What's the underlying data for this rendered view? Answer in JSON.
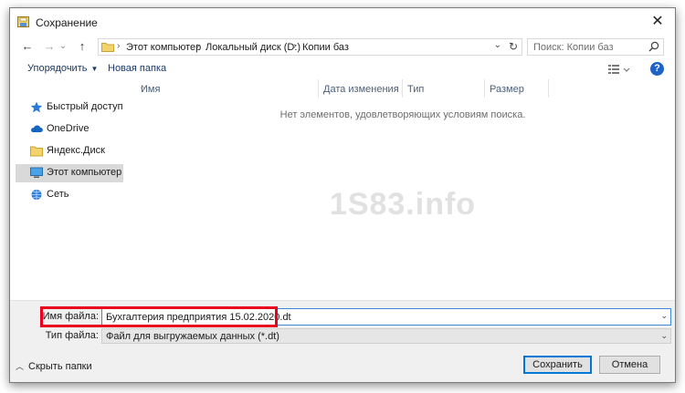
{
  "window": {
    "title": "Сохранение",
    "close_glyph": "✕"
  },
  "nav": {
    "back_glyph": "←",
    "forward_glyph": "→",
    "recent_glyph": "⌄",
    "up_glyph": "↑",
    "breadcrumbs": [
      "Этот компьютер",
      "Локальный диск (D:)",
      "Копии баз"
    ],
    "sep": "›",
    "addr_dropdown_glyph": "⌄",
    "refresh_glyph": "↻"
  },
  "search": {
    "placeholder": "Поиск: Копии баз"
  },
  "toolbar": {
    "organize_label": "Упорядочить",
    "organize_caret": "▼",
    "new_folder_label": "Новая папка",
    "help_glyph": "?"
  },
  "sidebar": {
    "items": [
      {
        "label": "Быстрый доступ",
        "icon": "star-icon"
      },
      {
        "label": "OneDrive",
        "icon": "cloud-icon"
      },
      {
        "label": "Яндекс.Диск",
        "icon": "folder-icon"
      },
      {
        "label": "Этот компьютер",
        "icon": "computer-icon",
        "selected": true
      },
      {
        "label": "Сеть",
        "icon": "network-icon"
      }
    ]
  },
  "file_list": {
    "columns": [
      "Имя",
      "Дата изменения",
      "Тип",
      "Размер"
    ],
    "sort_glyph": "^",
    "empty_message": "Нет элементов, удовлетворяющих условиям поиска."
  },
  "watermark": "1S83.info",
  "form": {
    "filename_label": "Имя файла:",
    "filename_value": "Бухгалтерия предприятия 15.02.2020.dt",
    "filetype_label": "Тип файла:",
    "filetype_value": "Файл для выгружаемых данных (*.dt)",
    "dropdown_glyph": "⌄"
  },
  "footer": {
    "hide_folders_chevron": "︿",
    "hide_folders_label": "Скрыть папки",
    "save_label": "Сохранить",
    "cancel_label": "Отмена"
  },
  "colors": {
    "accent": "#0078d7",
    "highlight": "#e8001c",
    "help": "#1f62c6"
  }
}
